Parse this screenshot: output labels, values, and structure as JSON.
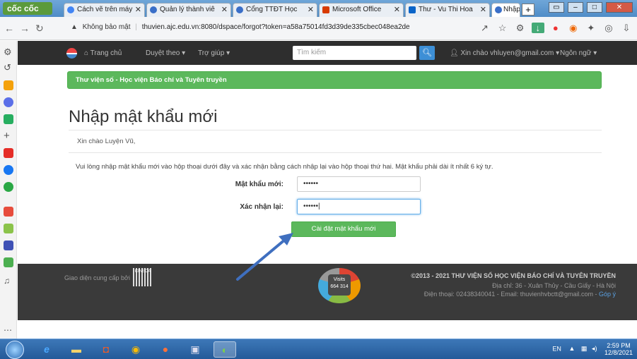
{
  "browser": {
    "brand": "cốc cốc",
    "tabs": [
      {
        "label": "Cách vẽ trên máy"
      },
      {
        "label": "Quản lý thành viê"
      },
      {
        "label": "Cổng TTĐT Học"
      },
      {
        "label": "Microsoft Office"
      },
      {
        "label": "Thư - Vu Thi Hoa"
      },
      {
        "label": "Nhập mật khẩu"
      }
    ],
    "security_label": "Không bảo mật",
    "url": "thuvien.ajc.edu.vn:8080/dspace/forgot?token=a58a75014fd3d39de335cbec048ea2de"
  },
  "site_nav": {
    "home": "Trang chủ",
    "browse": "Duyệt theo ▾",
    "help": "Trợ giúp ▾",
    "search_placeholder": "Tìm kiếm",
    "user": "Xin chào vhluyen@gmail.com ▾",
    "language": "Ngôn ngữ ▾"
  },
  "alert": "Thư viện số - Học viện Báo chí và Tuyên truyền",
  "page": {
    "title": "Nhập mật khẩu mới",
    "greeting": "Xin chào Luyện Vũ,",
    "instructions": "Vui lòng nhập mật khẩu mới vào hộp thoại dưới đây và xác nhận bằng cách nhập lại vào hộp thoại thứ hai. Mật khẩu phải dài ít nhất 6 ký tự.",
    "new_password_label": "Mật khẩu mới:",
    "new_password_value": "••••••",
    "confirm_label": "Xác nhận lại:",
    "confirm_value": "••••••|",
    "submit_label": "Cài đặt mật khẩu mới"
  },
  "footer": {
    "provided_by": "Giao diện cung cấp bởi",
    "cineca": "CINECA",
    "visits_label": "Visits",
    "visits_count": "664 314",
    "copyright": "©2013 - 2021 THƯ VIỆN SỐ HỌC VIỆN BÁO CHÍ VÀ TUYÊN TRUYỀN",
    "address": "Địa chỉ: 36 - Xuân Thủy - Cầu Giấy - Hà Nội",
    "contact_prefix": "Điện thoại: 02438340041 - Email: thuvienhvbctt@gmail.com - ",
    "feedback": "Góp ý"
  },
  "taskbar": {
    "language": "EN",
    "time": "2:59 PM",
    "date": "12/8/2021"
  }
}
